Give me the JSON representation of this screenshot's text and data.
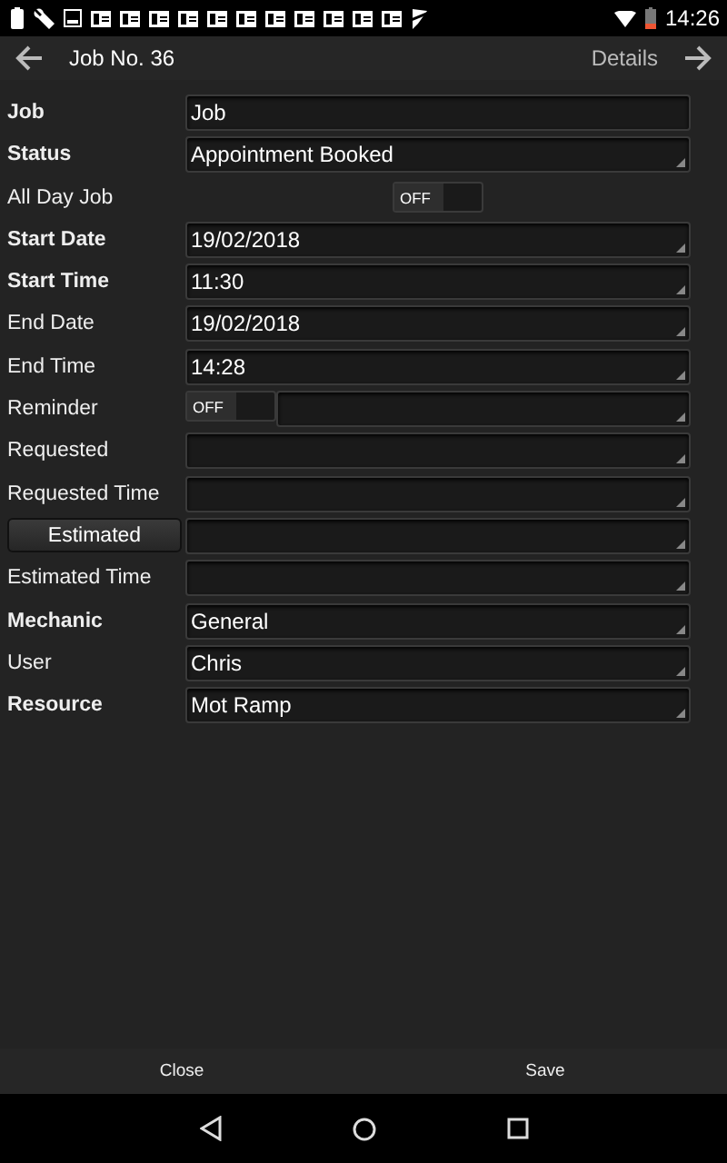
{
  "status_bar": {
    "time": "14:26"
  },
  "header": {
    "title": "Job No. 36",
    "next_label": "Details"
  },
  "form": [
    {
      "kind": "field",
      "label": "Job",
      "bold": true,
      "value": "Job",
      "dropdown": false
    },
    {
      "kind": "field",
      "label": "Status",
      "bold": true,
      "value": "Appointment Booked",
      "dropdown": true
    },
    {
      "kind": "toggle",
      "label": "All Day Job",
      "bold": false,
      "toggle_text": "OFF",
      "on": false
    },
    {
      "kind": "field",
      "label": "Start Date",
      "bold": true,
      "value": "19/02/2018",
      "dropdown": true
    },
    {
      "kind": "field",
      "label": "Start Time",
      "bold": true,
      "value": "11:30",
      "dropdown": true
    },
    {
      "kind": "field",
      "label": "End Date",
      "bold": false,
      "value": "19/02/2018",
      "dropdown": true
    },
    {
      "kind": "field",
      "label": "End Time",
      "bold": false,
      "value": "14:28",
      "dropdown": true
    },
    {
      "kind": "toggle_field",
      "label": "Reminder",
      "bold": false,
      "toggle_text": "OFF",
      "on": false
    },
    {
      "kind": "field",
      "label": "Requested",
      "bold": false,
      "dropdown": true
    },
    {
      "kind": "field",
      "label": "Requested Time",
      "bold": false,
      "dropdown": true
    },
    {
      "kind": "button_field",
      "label": "Estimated",
      "bold": false,
      "dropdown": true
    },
    {
      "kind": "field",
      "label": "Estimated Time",
      "bold": false,
      "dropdown": true
    },
    {
      "kind": "field",
      "label": "Mechanic",
      "bold": true,
      "value": "General",
      "dropdown": true
    },
    {
      "kind": "field",
      "label": "User",
      "bold": false,
      "value": "Chris",
      "dropdown": true
    },
    {
      "kind": "field",
      "label": "Resource",
      "bold": true,
      "value": "Mot Ramp",
      "dropdown": true
    }
  ],
  "footer": {
    "buttons": [
      "Close",
      "Save"
    ]
  }
}
